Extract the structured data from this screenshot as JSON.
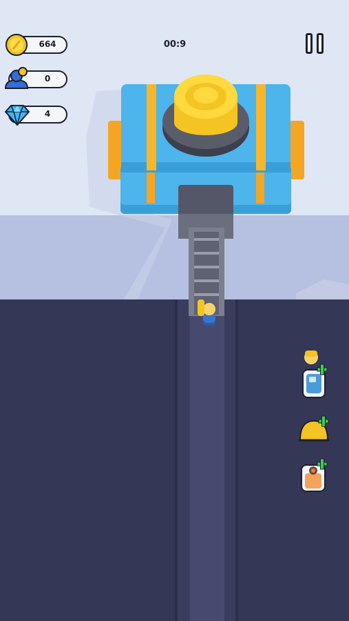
{
  "hud": {
    "coins": "664",
    "workers": "0",
    "gems": "4",
    "timer": "00:9"
  },
  "icons": {
    "coin": "coin-icon",
    "worker": "worker-icon",
    "gem": "diamond-icon",
    "pause": "pause-icon",
    "add_worker": "add-worker-icon",
    "upgrade_helmet": "upgrade-helmet-icon",
    "upgrade_bag": "upgrade-bag-icon"
  },
  "colors": {
    "sky": "#dfe7f5",
    "ground": "#343756",
    "machine_blue": "#4db4ec",
    "machine_yellow": "#ffd43a",
    "accent_orange": "#f4a623",
    "gem": "#3fb5f5",
    "plus_green": "#3ccf4e"
  }
}
